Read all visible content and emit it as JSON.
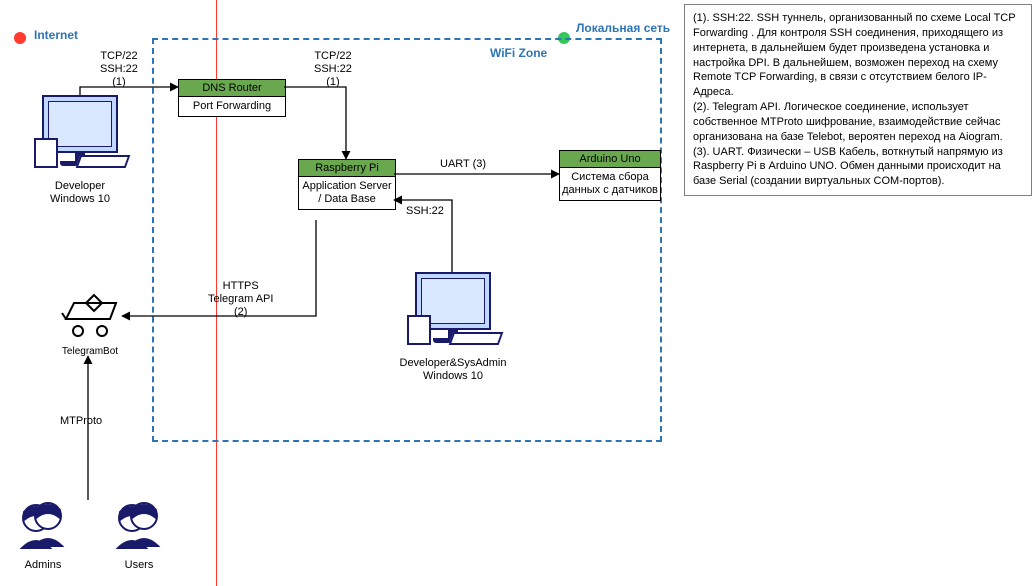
{
  "zones": {
    "internet": "Internet",
    "local": "Локальная сеть",
    "wifi": "WiFi Zone"
  },
  "nodes": {
    "dnsRouter": {
      "title": "DNS Router",
      "body": "Port Forwarding"
    },
    "raspberry": {
      "title": "Raspberry Pi",
      "body": "Application Server / Data Base"
    },
    "arduino": {
      "title": "Arduino Uno",
      "body": "Система сбора данных с датчиков"
    }
  },
  "pcs": {
    "devInternet": "Developer Windows 10",
    "devLocal": "Developer&SysAdmin Windows 10"
  },
  "bot": "TelegramBot",
  "users": {
    "admins": "Admins",
    "users": "Users"
  },
  "edges": {
    "devToRouter": "TCP/22\nSSH:22\n(1)",
    "routerToRasp": "TCP/22\nSSH:22\n(1)",
    "raspToArduino": "UART (3)",
    "devLocalToRasp": "SSH:22",
    "raspToBot": "HTTPS\nTelegram API\n(2)",
    "usersToBot": "MTProto"
  },
  "legend": {
    "l1": "(1). SSH:22. SSH туннель, организованный по схеме Local TCP Forwarding . Для контроля SSH соединения, приходящего из интернета, в дальнейшем будет произведена установка и настройка DPI. В дальнейшем, возможен переход на схему Remote TCP Forwarding, в связи с отсутствием белого IP-Адреса.",
    "l2": "(2). Telegram API. Логическое соединение, использует собственное MTProto шифрование, взаимодействие сейчас организована на базе Telebot, вероятен переход на Aiogram.",
    "l3": "(3). UART. Физически – USB Кабель, воткнутый напрямую из Raspberry Pi в Arduino UNO. Обмен данными происходит на базе Serial (создании виртуальных COM-портов)."
  }
}
